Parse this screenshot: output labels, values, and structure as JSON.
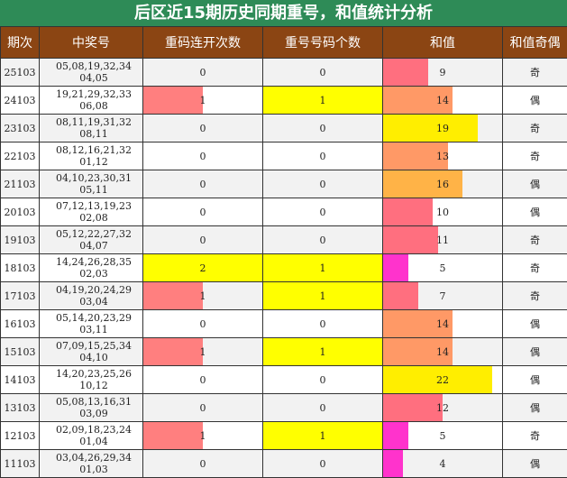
{
  "title": "后区近15期历史同期重号，和值统计分析",
  "chart_data": {
    "type": "table",
    "headers": [
      "期次",
      "中奖号",
      "重码连开次数",
      "重号号码个数",
      "和值",
      "和值奇偶"
    ],
    "sum_max": 24,
    "rows": [
      {
        "period": "25103",
        "numbers": "05,08,19,32,34 04,05",
        "repeat_streak": 0,
        "repeat_count": 0,
        "sum": 9,
        "parity": "奇"
      },
      {
        "period": "24103",
        "numbers": "19,21,29,32,33 06,08",
        "repeat_streak": 1,
        "repeat_count": 1,
        "sum": 14,
        "parity": "偶"
      },
      {
        "period": "23103",
        "numbers": "08,11,19,31,32 08,11",
        "repeat_streak": 0,
        "repeat_count": 0,
        "sum": 19,
        "parity": "奇"
      },
      {
        "period": "22103",
        "numbers": "08,12,16,21,32 01,12",
        "repeat_streak": 0,
        "repeat_count": 0,
        "sum": 13,
        "parity": "奇"
      },
      {
        "period": "21103",
        "numbers": "04,10,23,30,31 05,11",
        "repeat_streak": 0,
        "repeat_count": 0,
        "sum": 16,
        "parity": "偶"
      },
      {
        "period": "20103",
        "numbers": "07,12,13,19,23 02,08",
        "repeat_streak": 0,
        "repeat_count": 0,
        "sum": 10,
        "parity": "偶"
      },
      {
        "period": "19103",
        "numbers": "05,12,22,27,32 04,07",
        "repeat_streak": 0,
        "repeat_count": 0,
        "sum": 11,
        "parity": "奇"
      },
      {
        "period": "18103",
        "numbers": "14,24,26,28,35 02,03",
        "repeat_streak": 2,
        "repeat_count": 1,
        "sum": 5,
        "parity": "奇"
      },
      {
        "period": "17103",
        "numbers": "04,19,20,24,29 03,04",
        "repeat_streak": 1,
        "repeat_count": 1,
        "sum": 7,
        "parity": "奇"
      },
      {
        "period": "16103",
        "numbers": "05,14,20,23,29 03,11",
        "repeat_streak": 0,
        "repeat_count": 0,
        "sum": 14,
        "parity": "偶"
      },
      {
        "period": "15103",
        "numbers": "07,09,15,25,34 04,10",
        "repeat_streak": 1,
        "repeat_count": 1,
        "sum": 14,
        "parity": "偶"
      },
      {
        "period": "14103",
        "numbers": "14,20,23,25,26 10,12",
        "repeat_streak": 0,
        "repeat_count": 0,
        "sum": 22,
        "parity": "偶"
      },
      {
        "period": "13103",
        "numbers": "05,08,13,16,31 03,09",
        "repeat_streak": 0,
        "repeat_count": 0,
        "sum": 12,
        "parity": "偶"
      },
      {
        "period": "12103",
        "numbers": "02,09,18,23,24 01,04",
        "repeat_streak": 1,
        "repeat_count": 1,
        "sum": 5,
        "parity": "奇"
      },
      {
        "period": "11103",
        "numbers": "03,04,26,29,34 01,03",
        "repeat_streak": 0,
        "repeat_count": 0,
        "sum": 4,
        "parity": "偶"
      }
    ]
  },
  "colors": {
    "streak_one": "#ff7f7f",
    "streak_two": "#ffff00",
    "count_hl": "#ffff00",
    "sum_low": "#ff33cc",
    "sum_mid": "#ff6f7f",
    "sum_midhigh": "#ff9966",
    "sum_high": "#ffb347",
    "sum_top": "#ffee00"
  }
}
